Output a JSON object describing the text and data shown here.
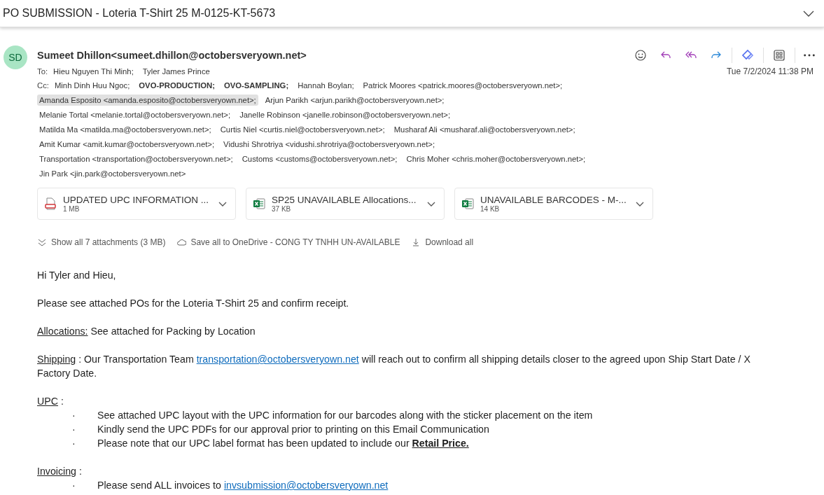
{
  "subject": {
    "title": "PO SUBMISSION - Loteria T-Shirt 25 M-0125-KT-5673"
  },
  "message": {
    "avatar": "SD",
    "sender": "Sumeet Dhillon<sumeet.dhillon@octobersveryown.net>",
    "date": "Tue 7/2/2024 11:38 PM",
    "to_label": "To:",
    "to": [
      {
        "text": "Hieu Nguyen Thi Minh;",
        "bold": false,
        "selected": false
      },
      {
        "text": "Tyler James Prince",
        "bold": false,
        "selected": false
      }
    ],
    "cc_label": "Cc:",
    "cc_lines": [
      [
        {
          "text": "Minh Dinh Huu Ngoc;",
          "bold": false,
          "selected": false
        },
        {
          "text": "OVO-PRODUCTION;",
          "bold": true,
          "selected": false
        },
        {
          "text": "OVO-SAMPLING;",
          "bold": true,
          "selected": false
        },
        {
          "text": "Hannah Boylan;",
          "bold": false,
          "selected": false
        },
        {
          "text": "Patrick Moores <patrick.moores@octobersveryown.net>;",
          "bold": false,
          "selected": false
        }
      ],
      [
        {
          "text": "Amanda Esposito <amanda.esposito@octobersveryown.net>;",
          "bold": false,
          "selected": true
        },
        {
          "text": "Arjun Parikh <arjun.parikh@octobersveryown.net>;",
          "bold": false,
          "selected": false
        }
      ],
      [
        {
          "text": "Melanie Tortal <melanie.tortal@octobersveryown.net>;",
          "bold": false,
          "selected": false
        },
        {
          "text": "Janelle Robinson <janelle.robinson@octobersveryown.net>;",
          "bold": false,
          "selected": false
        }
      ],
      [
        {
          "text": "Matilda Ma <matilda.ma@octobersveryown.net>;",
          "bold": false,
          "selected": false
        },
        {
          "text": "Curtis Niel <curtis.niel@octobersveryown.net>;",
          "bold": false,
          "selected": false
        },
        {
          "text": "Musharaf Ali <musharaf.ali@octobersveryown.net>;",
          "bold": false,
          "selected": false
        }
      ],
      [
        {
          "text": "Amit Kumar <amit.kumar@octobersveryown.net>;",
          "bold": false,
          "selected": false
        },
        {
          "text": "Vidushi Shrotriya <vidushi.shrotriya@octobersveryown.net>;",
          "bold": false,
          "selected": false
        }
      ],
      [
        {
          "text": "Transportation <transportation@octobersveryown.net>;",
          "bold": false,
          "selected": false
        },
        {
          "text": "Customs <customs@octobersveryown.net>;",
          "bold": false,
          "selected": false
        },
        {
          "text": "Chris Moher <chris.moher@octobersveryown.net>;",
          "bold": false,
          "selected": false
        }
      ],
      [
        {
          "text": "Jin Park <jin.park@octobersveryown.net>",
          "bold": false,
          "selected": false
        }
      ]
    ]
  },
  "attachments": [
    {
      "kind": "pdf",
      "name": "UPDATED UPC INFORMATION ...",
      "size": "1 MB"
    },
    {
      "kind": "excel",
      "name": "SP25 UNAVAILABLE Allocations...",
      "size": "37 KB"
    },
    {
      "kind": "excel",
      "name": "UNAVAILABLE BARCODES - M-...",
      "size": "14 KB"
    }
  ],
  "attachment_actions": [
    {
      "kind": "show",
      "label": "Show all 7 attachments (3 MB)"
    },
    {
      "kind": "save",
      "label": "Save all to OneDrive - CONG TY TNHH UN-AVAILABLE"
    },
    {
      "kind": "download",
      "label": "Download all"
    }
  ],
  "body": [
    {
      "kind": "para",
      "segments": [
        {
          "kind": "plain",
          "text": "Hi Tyler and Hieu,"
        }
      ]
    },
    {
      "kind": "para",
      "segments": [
        {
          "kind": "plain",
          "text": "Please see attached POs for the Loteria T-Shirt 25 and confirm receipt."
        }
      ]
    },
    {
      "kind": "para",
      "segments": [
        {
          "kind": "underline",
          "text": "Allocations:"
        },
        {
          "kind": "plain",
          "text": " See attached for Packing by Location"
        }
      ]
    },
    {
      "kind": "para",
      "segments": [
        {
          "kind": "underline",
          "text": "Shipping"
        },
        {
          "kind": "plain",
          "text": " : Our Transportation Team "
        },
        {
          "kind": "link",
          "text": "transportation@octobersveryown.net"
        },
        {
          "kind": "plain",
          "text": " will reach out to confirm all shipping details closer to the agreed upon Ship Start Date / X Factory Date."
        }
      ]
    },
    {
      "kind": "para",
      "segments": [
        {
          "kind": "underline",
          "text": "UPC"
        },
        {
          "kind": "plain",
          "text": " :"
        }
      ]
    },
    {
      "kind": "bullet",
      "bullet": "·",
      "segments": [
        {
          "kind": "plain",
          "text": "See attached UPC layout with the UPC information for our barcodes along with the sticker placement on the item"
        }
      ]
    },
    {
      "kind": "bullet",
      "bullet": "·",
      "segments": [
        {
          "kind": "plain",
          "text": "Kindly send the UPC PDFs for our approval prior to printing on this Email Communication"
        }
      ]
    },
    {
      "kind": "bullet",
      "bullet": "·",
      "segments": [
        {
          "kind": "plain",
          "text": "Please note that our UPC label format has been updated to include our "
        },
        {
          "kind": "strong",
          "text": "Retail Price."
        }
      ]
    },
    {
      "kind": "para",
      "segments": [
        {
          "kind": "underline",
          "text": "Invoicing"
        },
        {
          "kind": "plain",
          "text": " :"
        }
      ]
    },
    {
      "kind": "bullet",
      "bullet": "·",
      "segments": [
        {
          "kind": "plain",
          "text": "Please send ALL invoices to "
        },
        {
          "kind": "link",
          "text": "invsubmission@octobersveryown.net"
        }
      ]
    }
  ]
}
